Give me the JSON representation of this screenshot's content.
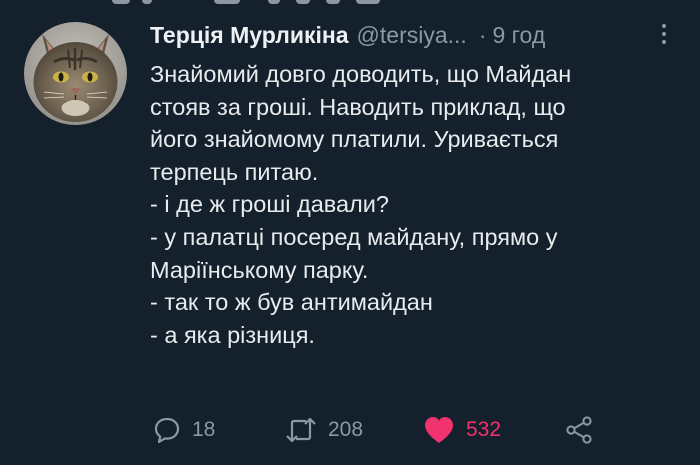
{
  "tweet": {
    "author_name": "Терція Мурликіна",
    "author_handle": "@tersiya...",
    "separator": "·",
    "time": "9 год",
    "lines": [
      "Знайомий довго доводить, що Майдан",
      "стояв за гроші. Наводить приклад, що",
      "його знайомому платили. Уривається",
      "терпець питаю.",
      "- і де ж гроші давали?",
      "- у палатці посеред майдану, прямо у",
      "Маріїнському парку.",
      "- так то ж був антимайдан",
      "- а яка різниця."
    ]
  },
  "actions": {
    "reply_icon": "reply-bubble-icon",
    "reply_count": "18",
    "retweet_icon": "retweet-icon",
    "retweet_count": "208",
    "like_icon": "heart-filled-icon",
    "like_count": "532",
    "share_icon": "share-icon"
  },
  "colors": {
    "background": "#14202c",
    "text": "#e7ebee",
    "muted": "#8b98a5",
    "like": "#f0326e"
  }
}
